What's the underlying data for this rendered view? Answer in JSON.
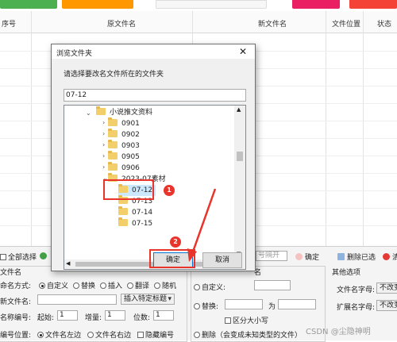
{
  "toolbar": {
    "colors": [
      "#4caf50",
      "#ff9800",
      "#f7f7f7",
      "#e91e63",
      "#f44336"
    ]
  },
  "table": {
    "headers": {
      "seq": "序号",
      "orig": "原文件名",
      "new": "新文件名",
      "location": "文件位置",
      "status": "状态"
    }
  },
  "dialog": {
    "title": "浏览文件夹",
    "prompt": "请选择要改名文件所在的文件夹",
    "path_value": "07-12",
    "tree": [
      {
        "label": "小说推文资料",
        "level": 0,
        "expanded": true
      },
      {
        "label": "0901",
        "level": 1
      },
      {
        "label": "0902",
        "level": 1
      },
      {
        "label": "0903",
        "level": 1
      },
      {
        "label": "0905",
        "level": 1
      },
      {
        "label": "0906",
        "level": 1
      },
      {
        "label": "2023-07素材",
        "level": 1,
        "expanded": true
      },
      {
        "label": "07-12",
        "level": 2,
        "selected": true
      },
      {
        "label": "07-13",
        "level": 2
      },
      {
        "label": "07-14",
        "level": 2
      },
      {
        "label": "07-15",
        "level": 2
      }
    ],
    "ok_label": "确定",
    "cancel_label": "取消",
    "marker1": "1",
    "marker2": "2"
  },
  "bottom": {
    "select_all": "全部选择",
    "section_filename": "文件名",
    "naming_label": "命名方式:",
    "naming_options": [
      "自定义",
      "替换",
      "插入",
      "翻译",
      "随机"
    ],
    "newname_label": "新文件名:",
    "insert_select": "插入特定标题",
    "seq_label": "名称编号:",
    "start_label": "起始:",
    "start_value": "1",
    "inc_label": "增量:",
    "inc_value": "1",
    "digits_label": "位数:",
    "digits_value": "1",
    "pos_label": "编号位置:",
    "pos_options": [
      "文件名左边",
      "文件名右边"
    ],
    "hide_number": "隐藏编号",
    "right_sep_placeholder": "号隔开",
    "confirm": "确定",
    "delete_selected": "删除已选",
    "clear_partial": "清",
    "group_name": "名",
    "custom_label": "自定义:",
    "replace_label": "替换:",
    "as_label": "为",
    "case_label": "区分大小写",
    "delete_label": "删除（会变成未知类型的文件）",
    "other_options": "其他选项",
    "name_case_label": "文件名字母:",
    "name_case_value": "不改变",
    "ext_case_label": "扩展名字母:",
    "ext_case_value": "不改变",
    "watermark": "CSDN @尘隐神明"
  }
}
